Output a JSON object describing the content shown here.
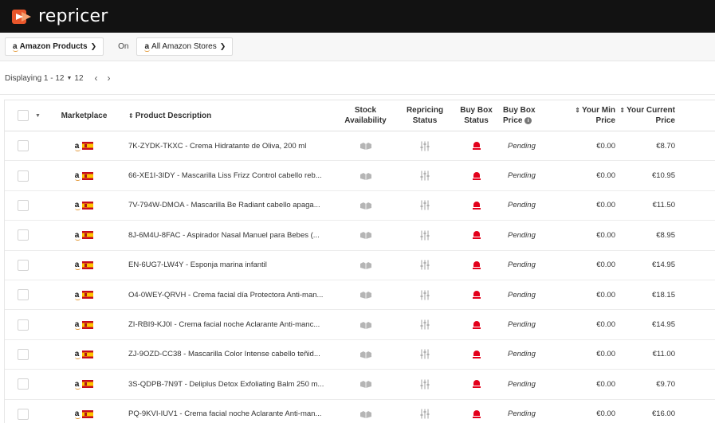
{
  "brand": {
    "name": "repricer",
    "accent": "#e8562b"
  },
  "filters": {
    "products": "Amazon Products",
    "on_label": "On",
    "stores": "All Amazon Stores"
  },
  "pager": {
    "displaying": "Displaying 1 - 12",
    "page_size": "12"
  },
  "columns": {
    "marketplace": "Marketplace",
    "description": "Product Description",
    "stock_line1": "Stock",
    "stock_line2": "Availability",
    "repricing_line1": "Repricing",
    "repricing_line2": "Status",
    "bbs_line1": "Buy Box",
    "bbs_line2": "Status",
    "bbp_line1": "Buy Box",
    "bbp_line2": "Price",
    "min_line1": "Your Min",
    "min_line2": "Price",
    "cur_line1": "Your Current",
    "cur_line2": "Price"
  },
  "rows": [
    {
      "desc": "7K-ZYDK-TKXC - Crema Hidratante de Oliva, 200 ml",
      "status": "Pending",
      "min": "€0.00",
      "cur": "€8.70"
    },
    {
      "desc": "66-XE1I-3IDY - Mascarilla Liss Frizz Control cabello reb...",
      "status": "Pending",
      "min": "€0.00",
      "cur": "€10.95"
    },
    {
      "desc": "7V-794W-DMOA - Mascarilla Be Radiant cabello apaga...",
      "status": "Pending",
      "min": "€0.00",
      "cur": "€11.50"
    },
    {
      "desc": "8J-6M4U-8FAC - Aspirador Nasal Manuel para Bebes (...",
      "status": "Pending",
      "min": "€0.00",
      "cur": "€8.95"
    },
    {
      "desc": "EN-6UG7-LW4Y - Esponja marina infantil",
      "status": "Pending",
      "min": "€0.00",
      "cur": "€14.95"
    },
    {
      "desc": "O4-0WEY-QRVH - Crema facial día Protectora Anti-man...",
      "status": "Pending",
      "min": "€0.00",
      "cur": "€18.15"
    },
    {
      "desc": "ZI-RBI9-KJ0I - Crema facial noche Aclarante Anti-manc...",
      "status": "Pending",
      "min": "€0.00",
      "cur": "€14.95"
    },
    {
      "desc": "ZJ-9OZD-CC38 - Mascarilla Color Intense cabello teñid...",
      "status": "Pending",
      "min": "€0.00",
      "cur": "€11.00"
    },
    {
      "desc": "3S-QDPB-7N9T - Deliplus Detox Exfoliating Balm 250 m...",
      "status": "Pending",
      "min": "€0.00",
      "cur": "€9.70"
    },
    {
      "desc": "PQ-9KVI-IUV1 - Crema facial noche Aclarante Anti-man...",
      "status": "Pending",
      "min": "€0.00",
      "cur": "€16.00"
    }
  ]
}
